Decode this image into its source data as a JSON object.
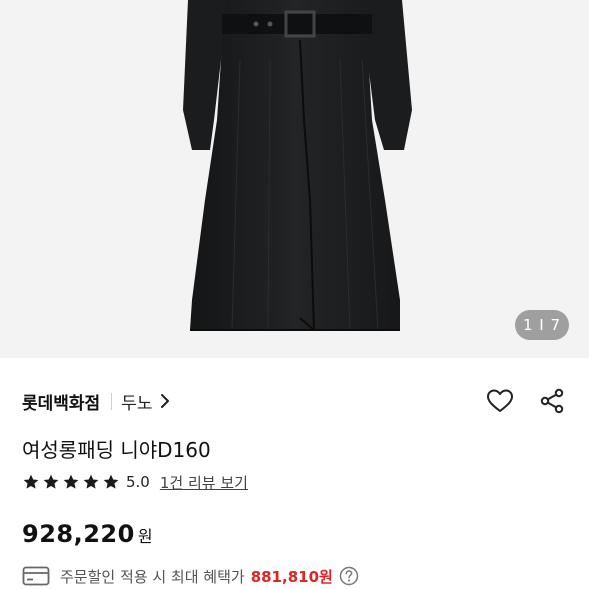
{
  "gallery": {
    "counter_current": "1",
    "counter_divider": "I",
    "counter_total": "7"
  },
  "store": {
    "brand": "롯데백화점",
    "sub_brand": "두노"
  },
  "product": {
    "title": "여성롱패딩 니야D160",
    "rating_score": "5.0",
    "stars": 5,
    "reviews_link": "1건 리뷰 보기",
    "price": "928,220",
    "price_unit": "원"
  },
  "benefit": {
    "text": "주문할인 적용 시 최대 혜택가",
    "price": "881,810원"
  },
  "colors": {
    "accent_red": "#e02424",
    "star": "#1a1a1a"
  },
  "icons": {
    "heart": "heart-icon",
    "share": "share-icon",
    "chevron": "chevron-right-icon",
    "card": "credit-card-icon",
    "help": "question-circle-icon"
  }
}
